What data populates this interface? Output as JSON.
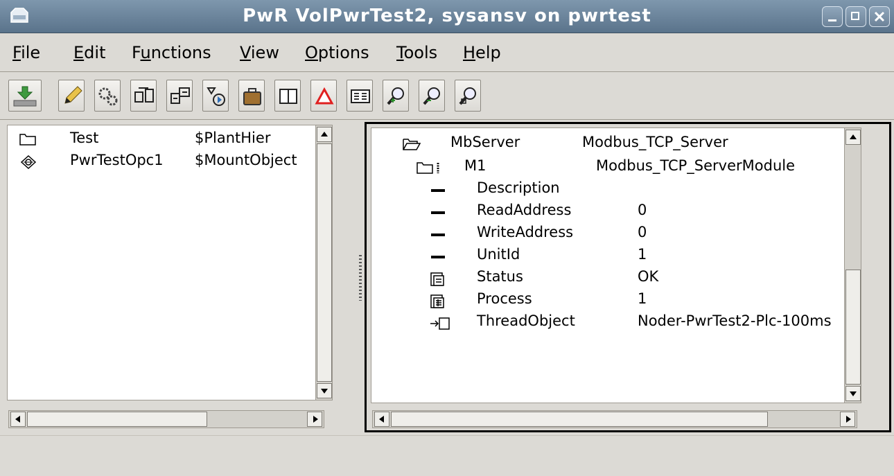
{
  "window": {
    "title": "PwR VolPwrTest2,   sysansv on pwrtest",
    "app_icon": "folder-icon",
    "buttons": [
      "minimize-icon",
      "maximize-icon",
      "close-icon"
    ]
  },
  "menu": {
    "file": {
      "u": "F",
      "rest": "ile"
    },
    "edit": {
      "u": "E",
      "rest": "dit"
    },
    "functions": {
      "pre": "F",
      "u": "u",
      "rest": "nctions"
    },
    "view": {
      "u": "V",
      "rest": "iew"
    },
    "options": {
      "u": "O",
      "rest": "ptions"
    },
    "tools": {
      "u": "T",
      "rest": "ools"
    },
    "help": {
      "u": "H",
      "rest": "elp"
    }
  },
  "toolbar": {
    "icons": [
      "save-icon",
      "edit-pencil-icon",
      "configure-gears-icon",
      "distribute-icon",
      "build-icon",
      "plc-trace-icon",
      "bag-icon",
      "split-view-icon",
      "alarm-triangle-icon",
      "attribute-editor-icon",
      "zoom-in-icon",
      "zoom-out-icon",
      "zoom-reset-icon"
    ]
  },
  "left_tree": {
    "rows": [
      {
        "icon": "folder-icon",
        "name": "Test",
        "class": "$PlantHier"
      },
      {
        "icon": "mount-object-icon",
        "name": "PwrTestOpc1",
        "class": "$MountObject"
      }
    ]
  },
  "right_tree": {
    "server": {
      "icon": "folder-open-icon",
      "name": "MbServer",
      "class": "Modbus_TCP_Server"
    },
    "module": {
      "icon": "folder-with-attr-icon",
      "name": "M1",
      "class": "Modbus_TCP_ServerModule"
    },
    "attributes": [
      {
        "icon": "attribute-icon",
        "name": "Description",
        "value": ""
      },
      {
        "icon": "attribute-icon",
        "name": "ReadAddress",
        "value": "0"
      },
      {
        "icon": "attribute-icon",
        "name": "WriteAddress",
        "value": "0"
      },
      {
        "icon": "attribute-icon",
        "name": "UnitId",
        "value": "1"
      },
      {
        "icon": "struct-attribute-icon",
        "name": "Status",
        "value": "OK"
      },
      {
        "icon": "struct-array-icon",
        "name": "Process",
        "value": "1"
      },
      {
        "icon": "object-reference-icon",
        "name": "ThreadObject",
        "value": "Noder-PwrTest2-Plc-100ms"
      }
    ]
  }
}
